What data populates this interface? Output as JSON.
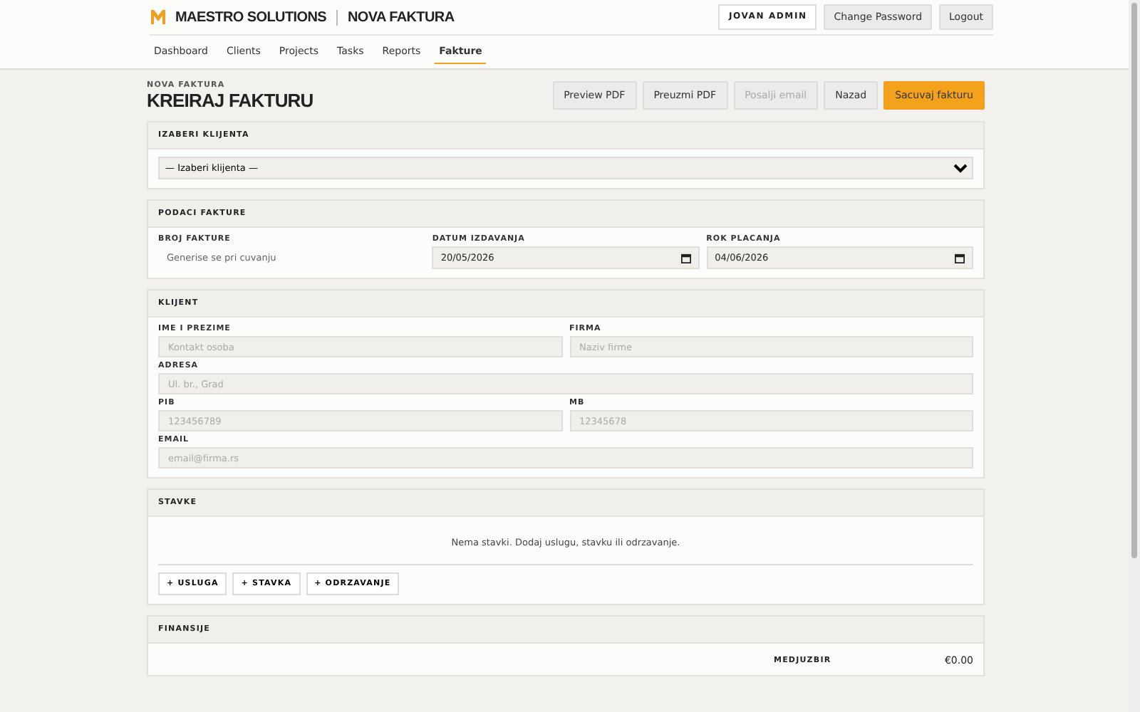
{
  "header": {
    "brand": "MAESTRO SOLUTIONS",
    "page": "NOVA FAKTURA",
    "user": "JOVAN ADMIN",
    "actions": [
      "Change Password",
      "Logout"
    ]
  },
  "nav": [
    {
      "label": "Dashboard",
      "selected": false
    },
    {
      "label": "Clients",
      "selected": false
    },
    {
      "label": "Projects",
      "selected": false
    },
    {
      "label": "Tasks",
      "selected": false
    },
    {
      "label": "Reports",
      "selected": false
    },
    {
      "label": "Fakture",
      "selected": true
    }
  ],
  "title": {
    "eyebrow": "NOVA FAKTURA",
    "heading": "KREIRAJ FAKTURU"
  },
  "toolbar": [
    {
      "label": "Preview PDF",
      "kind": "secondary",
      "disabled": false
    },
    {
      "label": "Preuzmi PDF",
      "kind": "secondary",
      "disabled": false
    },
    {
      "label": "Posalji email",
      "kind": "secondary",
      "disabled": true
    },
    {
      "label": "Nazad",
      "kind": "secondary",
      "disabled": false
    },
    {
      "label": "Sacuvaj fakturu",
      "kind": "primary",
      "disabled": false
    }
  ],
  "client_select": {
    "title": "IZABERI KLIJENTA",
    "value": "— Izaberi klijenta —"
  },
  "invoice_data": {
    "title": "PODACI FAKTURE",
    "fields": [
      {
        "label": "BROJ FAKTURE",
        "kind": "readonly",
        "value": "Generise se pri cuvanju"
      },
      {
        "label": "DATUM IZDAVANJA",
        "kind": "date",
        "value": "20/05/2026"
      },
      {
        "label": "ROK PLACANJA",
        "kind": "date",
        "value": "04/06/2026"
      }
    ]
  },
  "client": {
    "title": "KLIJENT",
    "rows": [
      [
        {
          "label": "IME I PREZIME",
          "placeholder": "Kontakt osoba"
        },
        {
          "label": "FIRMA",
          "placeholder": "Naziv firme"
        }
      ],
      [
        {
          "label": "ADRESA",
          "placeholder": "Ul. br., Grad"
        }
      ],
      [
        {
          "label": "PIB",
          "placeholder": "123456789"
        },
        {
          "label": "MB",
          "placeholder": "12345678"
        }
      ],
      [
        {
          "label": "EMAIL",
          "placeholder": "email@firma.rs"
        }
      ]
    ]
  },
  "items": {
    "title": "STAVKE",
    "empty": "Nema stavki. Dodaj uslugu, stavku ili odrzavanje.",
    "add_buttons": [
      "+ USLUGA",
      "+ STAVKA",
      "+ ODRZAVANJE"
    ]
  },
  "finance": {
    "title": "FINANSIJE",
    "rows": [
      {
        "label": "MEDJUZBIR",
        "value": "€0.00"
      }
    ]
  }
}
